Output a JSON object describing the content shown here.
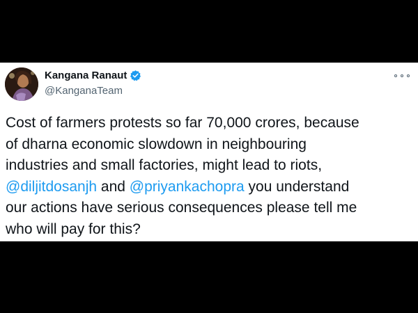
{
  "tweet": {
    "author": {
      "display_name": "Kangana Ranaut",
      "handle": "@KanganaTeam",
      "verified": true,
      "avatar_icon": "profile-photo"
    },
    "text_parts": {
      "line1": "Cost of farmers protests so far 70,000 crores, because",
      "line2": "of dharna economic slowdown in neighbouring",
      "line3": "industries and small factories, might lead to riots,",
      "mention1": "@diljitdosanjh",
      "and_word": " and ",
      "mention2": "@priyankachopra",
      "line4_rest": " you understand",
      "line5": "our actions have serious consequences please tell me",
      "line6": "who will pay for this?"
    },
    "colors": {
      "mention": "#1d9bf0",
      "verified_badge": "#1d9bf0",
      "text": "#0f1419",
      "handle": "#536471"
    },
    "icons": {
      "verified": "verified-badge-icon",
      "more": "more-options-icon"
    }
  }
}
